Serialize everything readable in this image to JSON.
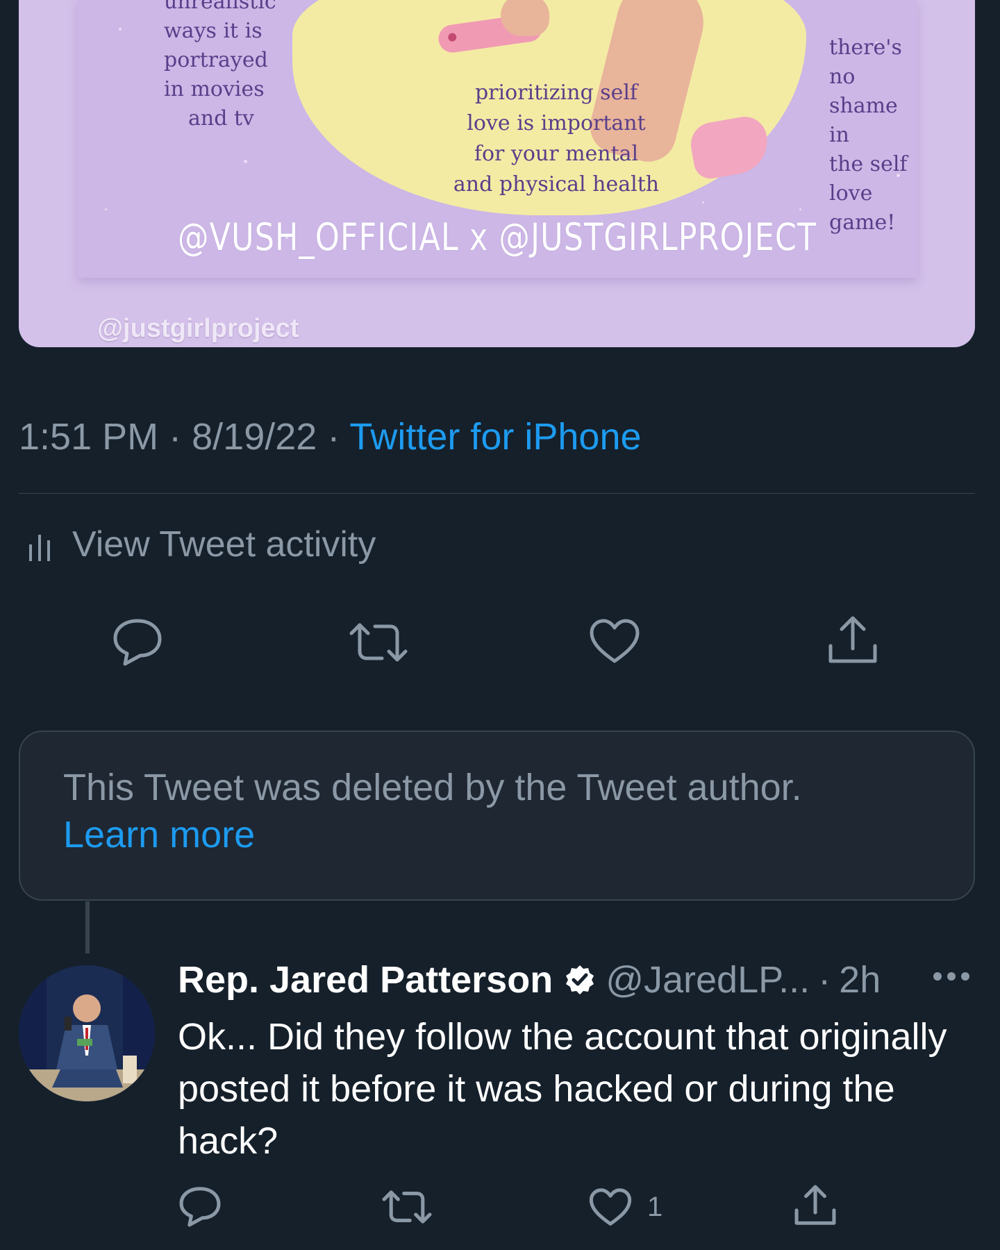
{
  "media": {
    "left_text": [
      "unrealistic",
      "ways it is",
      "portrayed",
      "in movies",
      "and tv"
    ],
    "middle_text": [
      "prioritizing self",
      "love is important",
      "for your mental",
      "and physical health"
    ],
    "right_text": [
      "there's no",
      "shame in",
      "the self",
      "love game!"
    ],
    "footer": "@VUSH_OFFICIAL x @JUSTGIRLPROJECT",
    "watermark": "@justgirlproject"
  },
  "tweet": {
    "time": "1:51 PM",
    "date": "8/19/22",
    "separator": "·",
    "source": "Twitter for iPhone",
    "activity_label": "View Tweet activity",
    "actions": [
      "reply-icon",
      "retweet-icon",
      "like-icon",
      "share-icon"
    ]
  },
  "deleted_notice": {
    "text": "This Tweet was deleted by the Tweet author.",
    "link": "Learn more"
  },
  "reply": {
    "name": "Rep. Jared Patterson",
    "handle": "@JaredLP...",
    "separator": "·",
    "age": "2h",
    "text": "Ok... Did they follow the account that originally posted it before it was hacked or during the hack?",
    "like_count": "1",
    "actions": [
      "reply-icon",
      "retweet-icon",
      "like-icon",
      "share-icon"
    ]
  },
  "colors": {
    "background": "#15202b",
    "accent": "#1d9bf0",
    "muted": "#8b98a5",
    "card_purple": "#ccb7e6",
    "card_yellow": "#f3eba4"
  }
}
